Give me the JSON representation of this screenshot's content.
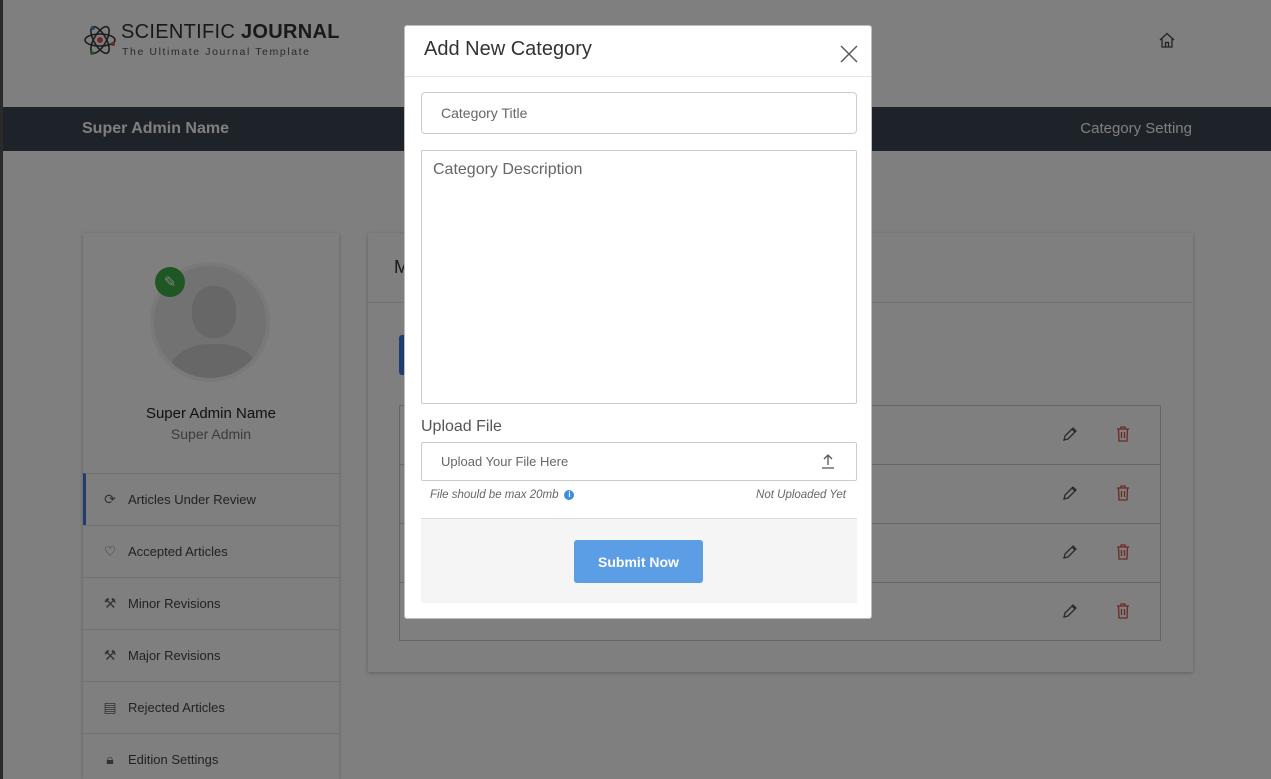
{
  "header": {
    "logo_title_light": "SCIENTIFIC ",
    "logo_title_bold": "JOURNAL",
    "logo_subtitle": "The Ultimate Journal Template",
    "home_icon": "home-icon"
  },
  "admin_bar": {
    "name": "Super Admin Name",
    "breadcrumb": "Category Setting"
  },
  "profile": {
    "name": "Super Admin Name",
    "role": "Super Admin",
    "edit_icon": "pencil-icon"
  },
  "sidebar": {
    "items": [
      {
        "label": "Articles Under Review",
        "icon": "refresh-icon",
        "active": true
      },
      {
        "label": "Accepted Articles",
        "icon": "heart-icon",
        "active": false
      },
      {
        "label": "Minor Revisions",
        "icon": "magic-wand-icon",
        "active": false
      },
      {
        "label": "Major Revisions",
        "icon": "magic-wand-icon",
        "active": false
      },
      {
        "label": "Rejected Articles",
        "icon": "barrier-icon",
        "active": false
      },
      {
        "label": "Edition Settings",
        "icon": "lock-icon",
        "active": false
      }
    ]
  },
  "main": {
    "title_visible_fragment": "M",
    "row_actions": [
      "pencil-icon",
      "trash-icon"
    ]
  },
  "modal": {
    "title": "Add New Category",
    "close_icon": "close-icon",
    "title_placeholder": "Category Title",
    "description_placeholder": "Category Description",
    "upload_label": "Upload File",
    "upload_placeholder": "Upload Your File Here",
    "upload_icon": "upload-icon",
    "hint_size": "File should be max 20mb",
    "hint_status": "Not Uploaded Yet",
    "submit_label": "Submit Now"
  },
  "colors": {
    "admin_bar": "#3d4452",
    "accent_blue": "#3b7ddd",
    "submit_blue": "#5b9ee6",
    "edit_badge_green": "#3fae49",
    "delete_red": "#d9534f"
  }
}
